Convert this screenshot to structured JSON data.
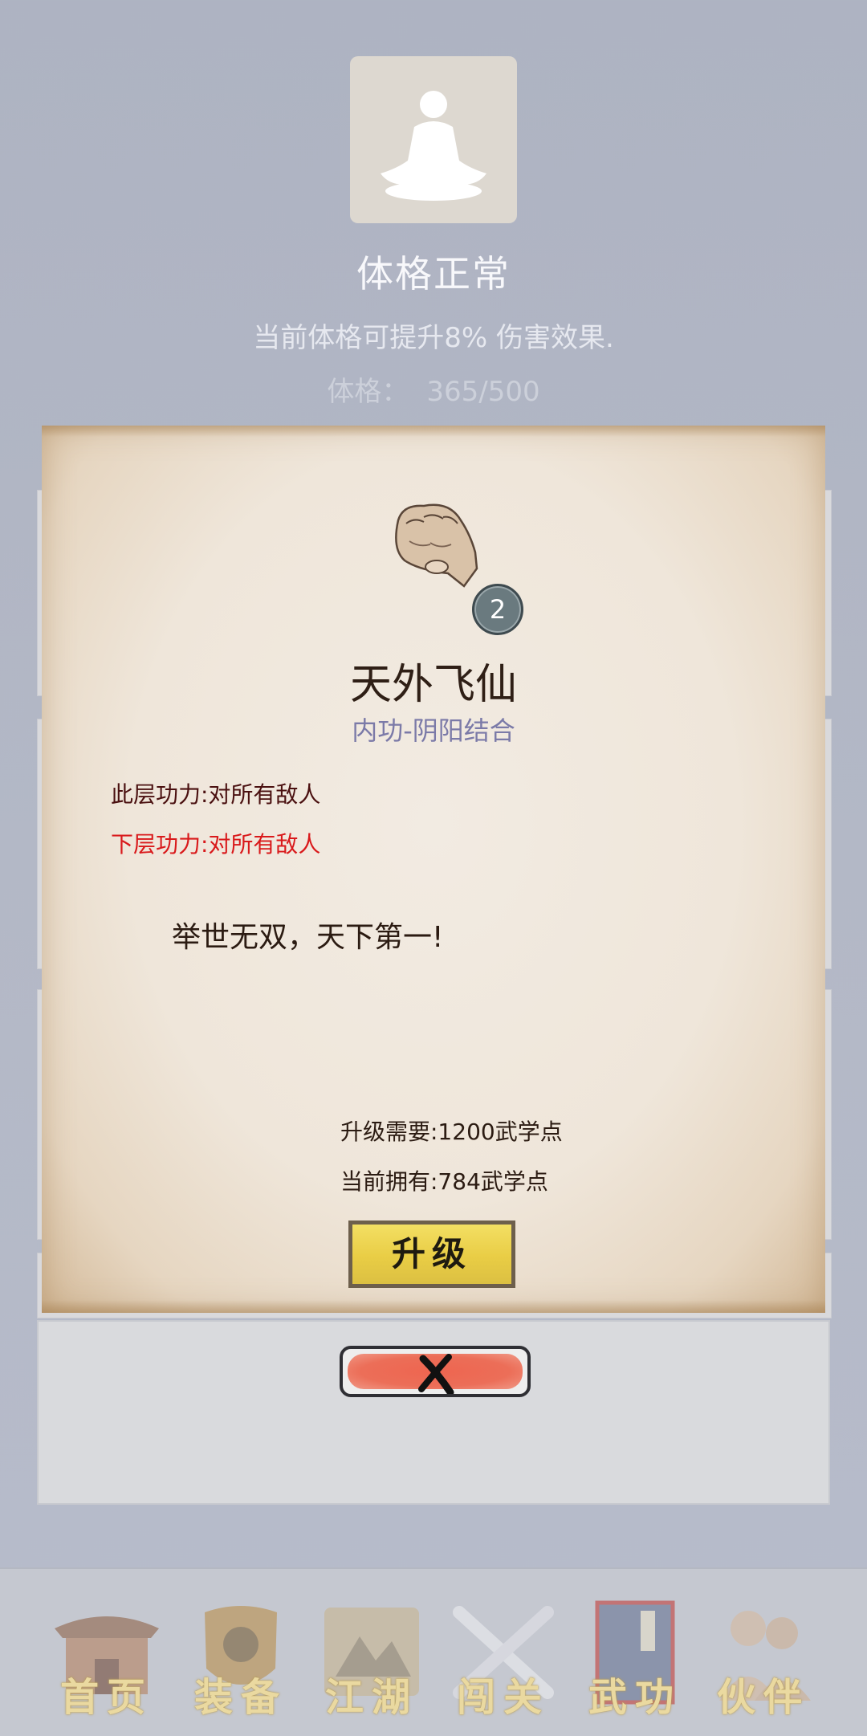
{
  "physique": {
    "status": "体格正常",
    "description": "当前体格可提升8% 伤害效果.",
    "label": "体格：",
    "value": "365/500",
    "icon": "meditation-icon"
  },
  "skill": {
    "icon": "fist-icon",
    "level": "2",
    "name": "天外飞仙",
    "type": "内功-阴阳结合",
    "this_layer": "此层功力:对所有敌人",
    "next_layer": "下层功力:对所有敌人",
    "motto": "举世无双，天下第一!",
    "upgrade_need": "升级需要:1200武学点",
    "current_have": "当前拥有:784武学点",
    "upgrade_label": "升级",
    "name_color": "#2f1f16",
    "type_color": "#7b7aa8",
    "next_layer_color": "#d9191b"
  },
  "close": {
    "icon": "close-x-icon",
    "color": "#ee6550"
  },
  "nav": {
    "items": [
      {
        "label": "首页",
        "icon": "temple-icon"
      },
      {
        "label": "装备",
        "icon": "armor-icon"
      },
      {
        "label": "江湖",
        "icon": "scroll-map-icon"
      },
      {
        "label": "闯关",
        "icon": "crossed-swords-icon"
      },
      {
        "label": "武功",
        "icon": "manual-book-icon"
      },
      {
        "label": "伙伴",
        "icon": "companions-icon"
      }
    ],
    "label_color": "#ead9a0"
  }
}
